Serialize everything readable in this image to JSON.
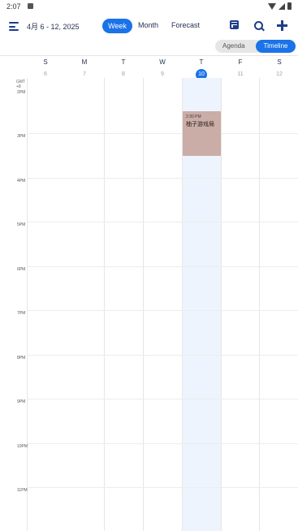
{
  "status_bar": {
    "time": "2:07"
  },
  "header": {
    "date_range": "4月 6 - 12, 2025",
    "tabs": [
      "Week",
      "Month",
      "Forecast"
    ],
    "active_tab": "Week"
  },
  "view_toggle": {
    "agenda": "Agenda",
    "timeline": "Timeline",
    "active": "Timeline"
  },
  "days": [
    {
      "letter": "S",
      "date": "6"
    },
    {
      "letter": "M",
      "date": "7"
    },
    {
      "letter": "T",
      "date": "8"
    },
    {
      "letter": "W",
      "date": "9"
    },
    {
      "letter": "T",
      "date": "10",
      "today": true
    },
    {
      "letter": "F",
      "date": "11"
    },
    {
      "letter": "S",
      "date": "12"
    }
  ],
  "timezone": {
    "line1": "GMT",
    "line2": "+8"
  },
  "hours": [
    "2PM",
    "3PM",
    "4PM",
    "5PM",
    "6PM",
    "7PM",
    "8PM",
    "9PM",
    "10PM",
    "11PM"
  ],
  "event": {
    "time": "2:30 PM",
    "title": "柚子游戏局",
    "color": "#c9ada6"
  },
  "colors": {
    "accent": "#1a73e8",
    "today_column": "#eef4fd"
  }
}
